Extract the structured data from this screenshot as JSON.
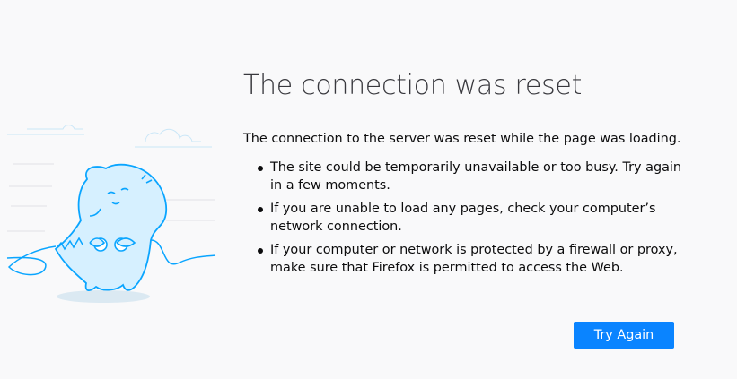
{
  "error": {
    "title": "The connection was reset",
    "intro": "The connection to the server was reset while the page was loading.",
    "bullets": [
      "The site could be temporarily unavailable or too busy. Try again in a few moments.",
      "If you are unable to load any pages, check your computer’s network connection.",
      "If your computer or network is protected by a firewall or proxy, make sure that Firefox is permitted to access the Web."
    ],
    "try_again_label": "Try Again"
  },
  "illustration": {
    "icon": "unplugged-creature-illustration"
  },
  "colors": {
    "background": "#f9f9fa",
    "accent": "#0a84ff",
    "illustration_blue": "#0aa5ff",
    "illustration_fill": "#d6f0ff",
    "title_text": "#38383d"
  }
}
